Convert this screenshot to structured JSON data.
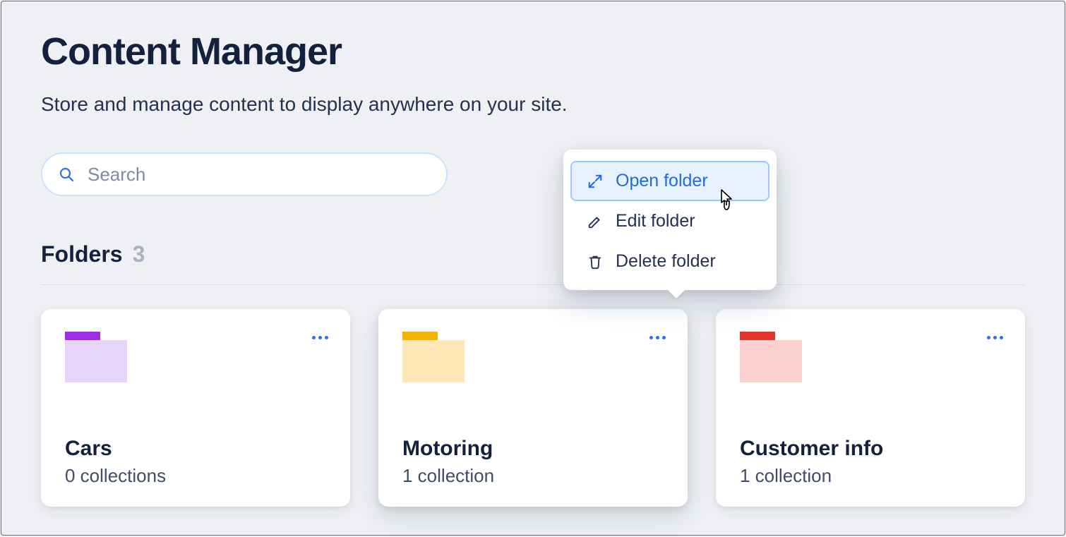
{
  "header": {
    "title": "Content Manager",
    "subtitle": "Store and manage content to display anywhere on your site."
  },
  "search": {
    "placeholder": "Search",
    "value": ""
  },
  "folders_section": {
    "label": "Folders",
    "count": "3"
  },
  "folders": [
    {
      "name": "Cars",
      "subtitle": "0 collections",
      "color": "cars"
    },
    {
      "name": "Motoring",
      "subtitle": "1 collection",
      "color": "motoring"
    },
    {
      "name": "Customer info",
      "subtitle": "1 collection",
      "color": "customer"
    }
  ],
  "context_menu": {
    "items": [
      {
        "label": "Open folder",
        "icon": "expand-icon",
        "selected": true
      },
      {
        "label": "Edit folder",
        "icon": "pencil-icon",
        "selected": false
      },
      {
        "label": "Delete folder",
        "icon": "trash-icon",
        "selected": false
      }
    ]
  },
  "icons": {
    "search": "search-icon",
    "more": "more-icon"
  },
  "colors": {
    "accent_blue": "#1f6be0",
    "text_dark": "#14213d"
  }
}
